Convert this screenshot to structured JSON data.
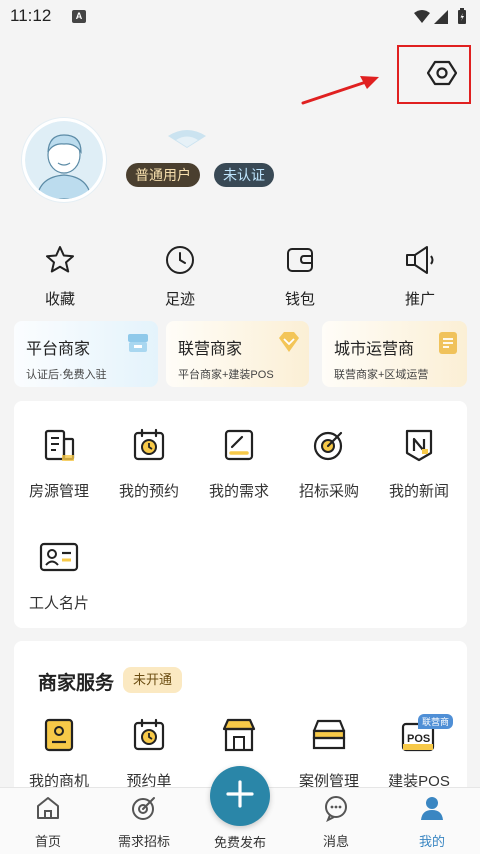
{
  "status_bar": {
    "time": "11:12",
    "notification_letter": "A"
  },
  "profile": {
    "badge_user_type": "普通用户",
    "badge_verification": "未认证"
  },
  "quick_actions": [
    {
      "label": "收藏",
      "icon": "star-icon"
    },
    {
      "label": "足迹",
      "icon": "clock-icon"
    },
    {
      "label": "钱包",
      "icon": "wallet-icon"
    },
    {
      "label": "推广",
      "icon": "megaphone-icon"
    }
  ],
  "merchant_cards": [
    {
      "title": "平台商家",
      "subtitle": "认证后·免费入驻",
      "icon": "store-icon"
    },
    {
      "title": "联营商家",
      "subtitle": "平台商家+建装POS",
      "icon": "diamond-icon"
    },
    {
      "title": "城市运营商",
      "subtitle": "联营商家+区域运营",
      "icon": "document-icon"
    }
  ],
  "tools": [
    {
      "label": "房源管理",
      "icon": "property-icon"
    },
    {
      "label": "我的预约",
      "icon": "calendar-clock-icon"
    },
    {
      "label": "我的需求",
      "icon": "edit-icon"
    },
    {
      "label": "招标采购",
      "icon": "target-icon"
    },
    {
      "label": "我的新闻",
      "icon": "news-icon"
    },
    {
      "label": "工人名片",
      "icon": "id-card-icon"
    }
  ],
  "merchant_services": {
    "title": "商家服务",
    "status_badge": "未开通",
    "items": [
      {
        "label": "我的商机",
        "icon": "contact-icon"
      },
      {
        "label": "预约单",
        "icon": "calendar-clock-icon"
      },
      {
        "label": "",
        "icon": "shop-icon"
      },
      {
        "label": "案例管理",
        "icon": "stack-icon"
      },
      {
        "label": "建装POS",
        "icon": "pos-icon",
        "tag": "联营商",
        "pos_text": "POS"
      }
    ]
  },
  "bottom_nav": {
    "items": [
      {
        "label": "首页",
        "icon": "home-icon"
      },
      {
        "label": "需求招标",
        "icon": "target-icon"
      },
      {
        "label": "免费发布",
        "icon": "plus-icon"
      },
      {
        "label": "消息",
        "icon": "chat-icon"
      },
      {
        "label": "我的",
        "icon": "user-icon"
      }
    ],
    "active": "我的"
  },
  "colors": {
    "accent_blue": "#2a86a8",
    "active_tab": "#3a86c2",
    "highlight_red": "#e02020",
    "icon_yellow": "#f7c948"
  }
}
